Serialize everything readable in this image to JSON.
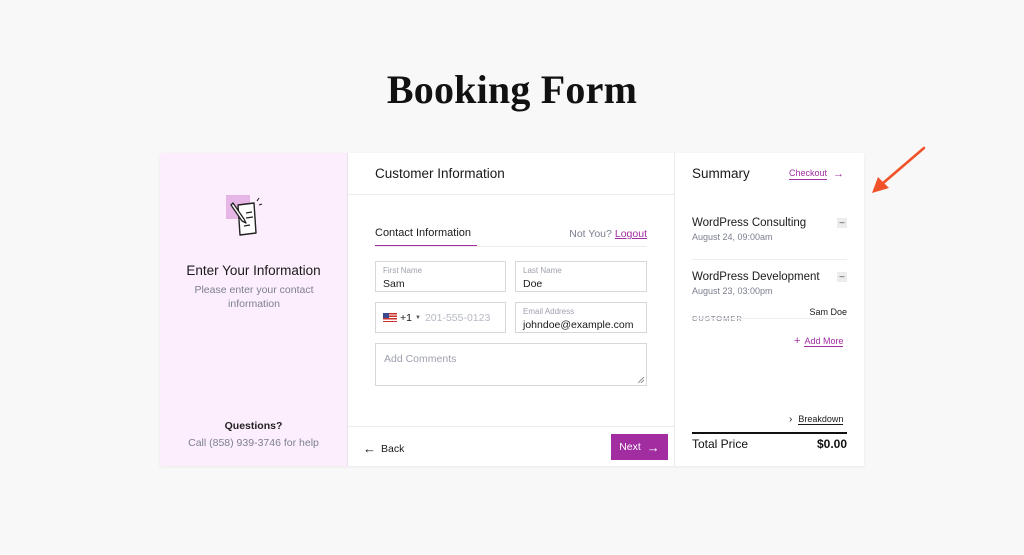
{
  "page": {
    "title": "Booking Form"
  },
  "left_panel": {
    "icon": "document-pen-icon",
    "title": "Enter Your Information",
    "subtitle": "Please enter your contact information",
    "questions_title": "Questions?",
    "questions_text": "Call (858) 939-3746 for help"
  },
  "customer": {
    "header": "Customer Information",
    "tab_label": "Contact Information",
    "not_you": "Not You?",
    "logout": "Logout",
    "first_name": {
      "label": "First Name",
      "value": "Sam"
    },
    "last_name": {
      "label": "Last Name",
      "value": "Doe"
    },
    "phone": {
      "country_code": "+1",
      "placeholder": "201-555-0123"
    },
    "email": {
      "label": "Email Address",
      "value": "johndoe@example.com"
    },
    "comments": {
      "placeholder": "Add Comments"
    },
    "back_label": "Back",
    "next_label": "Next"
  },
  "summary": {
    "title": "Summary",
    "checkout": "Checkout",
    "services": [
      {
        "name": "WordPress Consulting",
        "date": "August 24, 09:00am"
      },
      {
        "name": "WordPress Development",
        "date": "August 23, 03:00pm"
      }
    ],
    "customer_key": "CUSTOMER",
    "customer_value": "Sam Doe",
    "add_more": "Add More",
    "breakdown": "Breakdown",
    "total_label": "Total Price",
    "total_value": "$0.00"
  },
  "colors": {
    "accent": "#a12da0",
    "left_bg": "#fdeefd",
    "annotation_arrow": "#f0522a"
  }
}
